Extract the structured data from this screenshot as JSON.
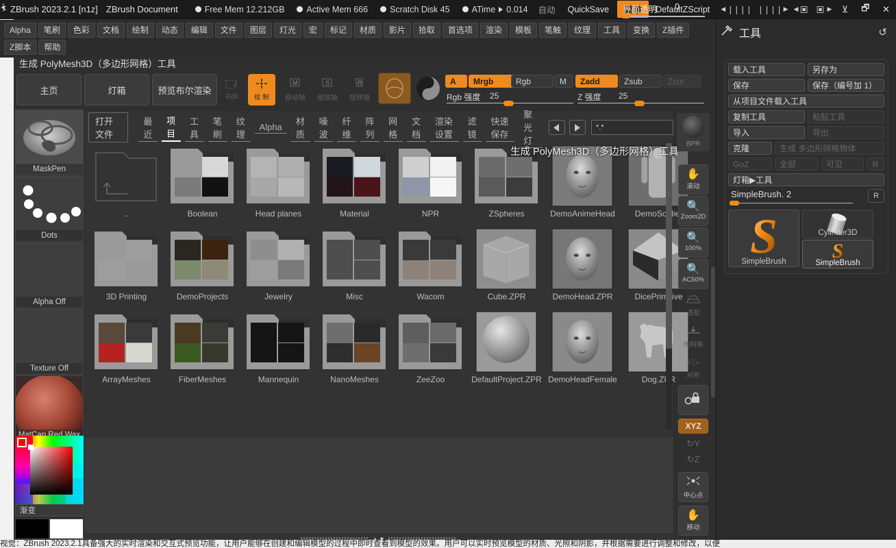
{
  "titlebar": {
    "logo_icon": "zbrush-logo-icon",
    "app_title": "ZBrush 2023.2.1 [n1z]",
    "document_name": "ZBrush Document",
    "stats": [
      {
        "label": "Free Mem 12.212GB"
      },
      {
        "label": "Active Mem 666"
      },
      {
        "label": "Scratch Disk 45"
      },
      {
        "label": "ATime"
      }
    ],
    "atime_value": "0.014",
    "auto_label": "自动",
    "quicksave_label": "QuickSave",
    "transparency_label": "界面透明",
    "transparency_value": "0",
    "menu_button": "菜单",
    "zscript_label": "DefaultZScript",
    "minimize_icon": "minimize-icon",
    "restore_icon": "restore-icon",
    "close_icon": "close-icon"
  },
  "menubar": {
    "items": [
      "Alpha",
      "笔刷",
      "色彩",
      "文档",
      "绘制",
      "动态",
      "编辑",
      "文件",
      "图层",
      "灯光",
      "宏",
      "标记",
      "材质",
      "影片",
      "拾取",
      "首选项",
      "渲染",
      "模板",
      "笔触",
      "纹理",
      "工具",
      "变换",
      "Z插件",
      "Z脚本",
      "帮助"
    ]
  },
  "toolbar": {
    "title": "生成 PolyMesh3D（多边形网格）工具",
    "buttons": [
      {
        "label": "主页",
        "name": "home-button"
      },
      {
        "label": "灯箱",
        "name": "lightbox-button"
      },
      {
        "label": "预览布尔渲染",
        "name": "preview-boolean-render-button"
      }
    ],
    "mode_icons": [
      {
        "label": "Edit",
        "name": "edit-mode-button",
        "state": "dim"
      },
      {
        "label": "绘 制",
        "name": "draw-mode-button",
        "state": "active"
      },
      {
        "label": "移动轴",
        "name": "move-axis-button",
        "state": "dim"
      },
      {
        "label": "缩放轴",
        "name": "scale-axis-button",
        "state": "dim"
      },
      {
        "label": "旋转轴",
        "name": "rotate-axis-button",
        "state": "dim"
      }
    ],
    "channels": [
      {
        "label": "A",
        "on": true,
        "name": "channel-a"
      },
      {
        "label": "Mrgb",
        "on": true,
        "name": "channel-mrgb"
      },
      {
        "label": "Rgb",
        "on": false,
        "name": "channel-rgb"
      },
      {
        "label": "M",
        "on": false,
        "name": "channel-m"
      },
      {
        "label": "Zadd",
        "on": true,
        "name": "channel-zadd"
      },
      {
        "label": "Zsub",
        "on": false,
        "name": "channel-zsub"
      },
      {
        "label": "Zcut",
        "on": false,
        "disabled": true,
        "name": "channel-zcut"
      }
    ],
    "rgb_intensity_label": "Rgb 强度",
    "rgb_intensity_value": "25",
    "z_intensity_label": "Z 强度",
    "z_intensity_value": "25"
  },
  "left_shelf": {
    "items": [
      {
        "label": "MaskPen",
        "name": "brush-selector",
        "icon": "maskpen-thumb"
      },
      {
        "label": "Dots",
        "name": "stroke-selector",
        "icon": "dots-thumb"
      },
      {
        "label": "Alpha Off",
        "name": "alpha-selector",
        "icon": "alpha-off-thumb"
      },
      {
        "label": "Texture Off",
        "name": "texture-selector",
        "icon": "texture-off-thumb"
      },
      {
        "label": "MatCap Red Wax",
        "name": "material-selector",
        "icon": "matcap-red-wax-thumb"
      }
    ],
    "gradient_label": "渐变",
    "primary_swatch": "#000000",
    "secondary_swatch": "#ffffff"
  },
  "lightbox": {
    "open_file_label": "打开文件",
    "tabs": [
      {
        "label": "最近",
        "selected": false
      },
      {
        "label": "项目",
        "selected": true
      },
      {
        "label": "工具",
        "selected": false
      },
      {
        "label": "笔刷",
        "selected": false
      },
      {
        "label": "纹理",
        "selected": false
      },
      {
        "label": "Alpha",
        "selected": false
      },
      {
        "label": "材质",
        "selected": false
      },
      {
        "label": "噪波",
        "selected": false
      },
      {
        "label": "纤维",
        "selected": false
      },
      {
        "label": "阵列",
        "selected": false
      },
      {
        "label": "网格",
        "selected": false
      },
      {
        "label": "文档",
        "selected": false
      },
      {
        "label": "渲染设置",
        "selected": false
      },
      {
        "label": "滤镜",
        "selected": false
      },
      {
        "label": "快速保存",
        "selected": false
      },
      {
        "label": "聚光灯",
        "selected": false
      }
    ],
    "prev_icon": "prev-arrow-icon",
    "next_icon": "next-arrow-icon",
    "filter_value": "*.*",
    "overlay_title": "生成 PolyMesh3D（多边形网格）工具",
    "items": [
      {
        "label": "..",
        "type": "up-folder"
      },
      {
        "label": "Boolean",
        "type": "folder"
      },
      {
        "label": "Head planes",
        "type": "folder"
      },
      {
        "label": "Material",
        "type": "folder"
      },
      {
        "label": "NPR",
        "type": "folder"
      },
      {
        "label": "ZSpheres",
        "type": "folder"
      },
      {
        "label": "DemoAnimeHead",
        "type": "file"
      },
      {
        "label": "DemoSoldier",
        "type": "file"
      },
      {
        "label": "3D Printing",
        "type": "folder"
      },
      {
        "label": "DemoProjects",
        "type": "folder"
      },
      {
        "label": "Jewelry",
        "type": "folder"
      },
      {
        "label": "Misc",
        "type": "folder"
      },
      {
        "label": "Wacom",
        "type": "folder"
      },
      {
        "label": "Cube.ZPR",
        "type": "file"
      },
      {
        "label": "DemoHead.ZPR",
        "type": "file"
      },
      {
        "label": "DicePrimitive",
        "type": "file"
      },
      {
        "label": "ArrayMeshes",
        "type": "folder"
      },
      {
        "label": "FiberMeshes",
        "type": "folder"
      },
      {
        "label": "Mannequin",
        "type": "folder"
      },
      {
        "label": "NanoMeshes",
        "type": "folder"
      },
      {
        "label": "ZeeZoo",
        "type": "folder"
      },
      {
        "label": "DefaultProject.ZPR",
        "type": "file"
      },
      {
        "label": "DemoHeadFemale",
        "type": "file"
      },
      {
        "label": "Dog.ZPR",
        "type": "file"
      }
    ]
  },
  "right_shelf": {
    "bpr_label": "BPR",
    "buttons": [
      {
        "label": "滚动",
        "icon": "hand-scroll-icon",
        "state": "normal",
        "name": "scroll-button"
      },
      {
        "label": "Zoom2D",
        "icon": "zoom-2d-icon",
        "state": "normal",
        "name": "zoom2d-button"
      },
      {
        "label": "100%",
        "icon": "actual-size-icon",
        "state": "normal",
        "name": "actual-size-button"
      },
      {
        "label": "AC50%",
        "icon": "antialias-half-icon",
        "state": "normal",
        "name": "ac50-button"
      },
      {
        "label": "透视",
        "icon": "perspective-icon",
        "state": "dim",
        "name": "perspective-button"
      },
      {
        "label": "地网格",
        "icon": "floor-grid-icon",
        "state": "dim",
        "name": "floor-button"
      },
      {
        "label": "对称",
        "icon": "symmetry-icon",
        "state": "dim",
        "name": "symmetry-button"
      },
      {
        "label": "",
        "icon": "lock-camera-icon",
        "state": "normal",
        "name": "lock-camera-button"
      },
      {
        "label": "XYZ",
        "icon": "rotate-xyz-icon",
        "state": "on",
        "name": "rotate-xyz-button"
      },
      {
        "label": "Y",
        "icon": "rotate-y-icon",
        "state": "dim",
        "name": "rotate-y-button"
      },
      {
        "label": "Z",
        "icon": "rotate-z-icon",
        "state": "dim",
        "name": "rotate-z-button"
      },
      {
        "label": "中心点",
        "icon": "center-icon",
        "state": "normal",
        "name": "center-button"
      },
      {
        "label": "移动",
        "icon": "move-icon",
        "state": "normal",
        "name": "move-button"
      }
    ]
  },
  "tool_panel": {
    "title": "工具",
    "hammer_icon": "hammer-icon",
    "refresh_icon": "refresh-icon",
    "rows": [
      [
        {
          "label": "载入工具",
          "off": false
        },
        {
          "label": "另存为",
          "off": false
        }
      ],
      [
        {
          "label": "保存",
          "off": false
        },
        {
          "label": "保存（编号加 1）",
          "off": false
        }
      ],
      [
        {
          "label": "从项目文件载入工具",
          "off": false
        }
      ],
      [
        {
          "label": "复制工具",
          "off": false
        },
        {
          "label": "粘贴工具",
          "off": true
        }
      ],
      [
        {
          "label": "导入",
          "off": false
        },
        {
          "label": "导出",
          "off": true
        }
      ],
      [
        {
          "label": "克隆",
          "off": false,
          "narrow": true
        },
        {
          "label": "生成 多边形网格物体",
          "off": true
        }
      ],
      [
        {
          "label": "GoZ",
          "off": true,
          "narrow": true
        },
        {
          "label": "全部",
          "off": true,
          "narrow": true
        },
        {
          "label": "可见",
          "off": true
        },
        {
          "label": "R",
          "off": true,
          "tiny": true
        }
      ],
      [
        {
          "label": "灯箱▶工具",
          "off": false
        }
      ]
    ],
    "slider_label": "SimpleBrush. 2",
    "slider_r_label": "R",
    "thumbs": [
      {
        "label": "SimpleBrush",
        "name": "tool-thumb-simplebrush-large",
        "selected": true
      },
      {
        "label": "Cylinder3D",
        "name": "tool-thumb-cylinder3d",
        "selected": false
      },
      {
        "label": "SimpleBrush",
        "name": "tool-thumb-simplebrush-small",
        "selected": true
      }
    ]
  },
  "statusbar": {
    "text": "视觉：ZBrush 2023.2.1具备强大的实时渲染和交互式预览功能，让用户能够在创建和编辑模型的过程中即时查看到模型的效果。用户可以实时预览模型的材质、光照和阴影，并根据需要进行调整和修改，以便"
  }
}
